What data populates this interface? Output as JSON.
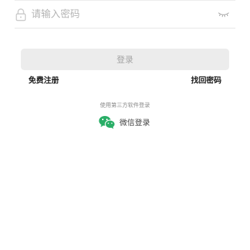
{
  "password": {
    "placeholder": "请输入密码",
    "value": ""
  },
  "actions": {
    "login_label": "登录",
    "register_label": "免费注册",
    "forgot_label": "找回密码"
  },
  "third_party": {
    "title": "使用第三方软件登录",
    "wechat_label": "微信登录"
  },
  "icons": {
    "lock": "lock-icon",
    "password_visibility": "eye-closed-icon",
    "wechat": "wechat-icon"
  },
  "colors": {
    "wechat_green": "#2aae67",
    "button_bg": "#ececec",
    "button_text": "#a3a3a3",
    "placeholder": "#b5b5b5"
  }
}
